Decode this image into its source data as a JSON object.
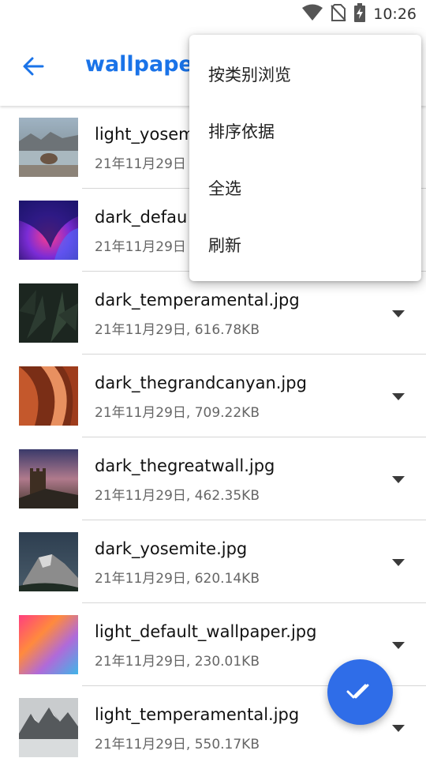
{
  "status_bar": {
    "time": "10:26",
    "icons": [
      "wifi-icon",
      "no-sim-icon",
      "battery-charging-icon"
    ]
  },
  "app_bar": {
    "title": "wallpaper",
    "back_icon": "arrow-back-icon"
  },
  "overflow_menu": {
    "items": [
      {
        "label": "按类别浏览"
      },
      {
        "label": "排序依据"
      },
      {
        "label": "全选"
      },
      {
        "label": "刷新"
      }
    ]
  },
  "files": [
    {
      "name": "light_yosem",
      "meta": "21年11月29日",
      "thumb": "yosemite-lake"
    },
    {
      "name": "dark_defau",
      "meta": "21年11月29日",
      "thumb": "purple-aurora"
    },
    {
      "name": "dark_temperamental.jpg",
      "meta": "21年11月29日, 616.78KB",
      "thumb": "dark-leaves"
    },
    {
      "name": "dark_thegrandcanyan.jpg",
      "meta": "21年11月29日, 709.22KB",
      "thumb": "canyon"
    },
    {
      "name": "dark_thegreatwall.jpg",
      "meta": "21年11月29日, 462.35KB",
      "thumb": "great-wall"
    },
    {
      "name": "dark_yosemite.jpg",
      "meta": "21年11月29日, 620.14KB",
      "thumb": "half-dome"
    },
    {
      "name": "light_default_wallpaper.jpg",
      "meta": "21年11月29日, 230.01KB",
      "thumb": "gradient"
    },
    {
      "name": "light_temperamental.jpg",
      "meta": "21年11月29日, 550.17KB",
      "thumb": "snowy-peaks"
    }
  ],
  "fab": {
    "icon": "double-check-icon"
  },
  "colors": {
    "accent": "#1a73e8",
    "fab": "#2f6de8"
  }
}
